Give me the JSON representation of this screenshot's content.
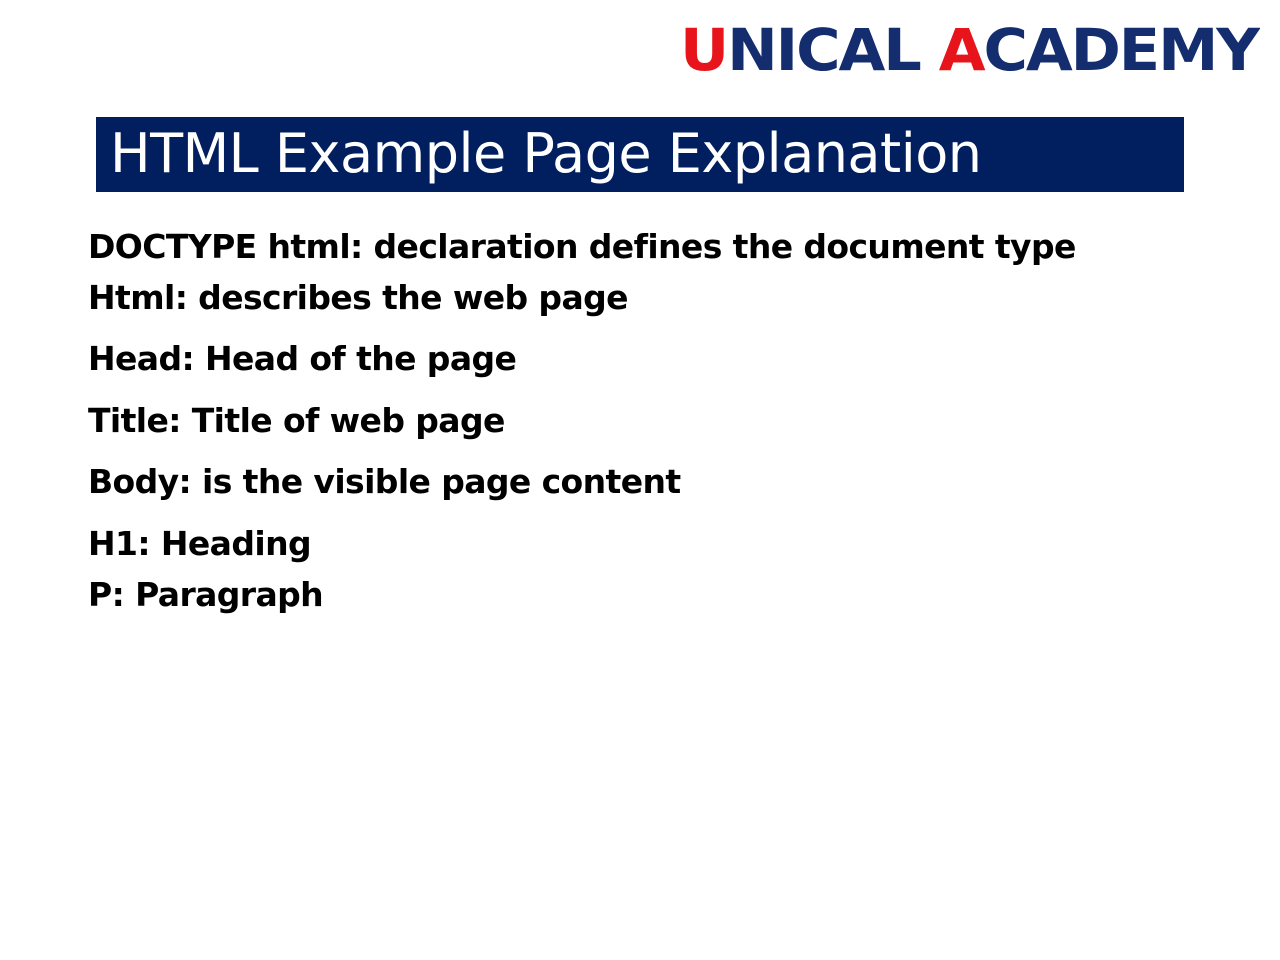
{
  "logo": {
    "text_part1": "U",
    "text_part2": "NICAL ",
    "text_part3": "A",
    "text_part4": "CADEMY",
    "colors": {
      "red": "#e8141b",
      "navy": "#132d6e"
    }
  },
  "title": "HTML Example Page Explanation",
  "lines": [
    "DOCTYPE html: declaration defines the document type",
    "Html: describes the web page",
    "Head: Head of the page",
    "Title: Title of web page",
    "Body: is the visible page content",
    "H1: Heading",
    "P: Paragraph"
  ],
  "colors": {
    "title_bar": "#011e5e",
    "title_text": "#ffffff",
    "body_text": "#000000"
  }
}
